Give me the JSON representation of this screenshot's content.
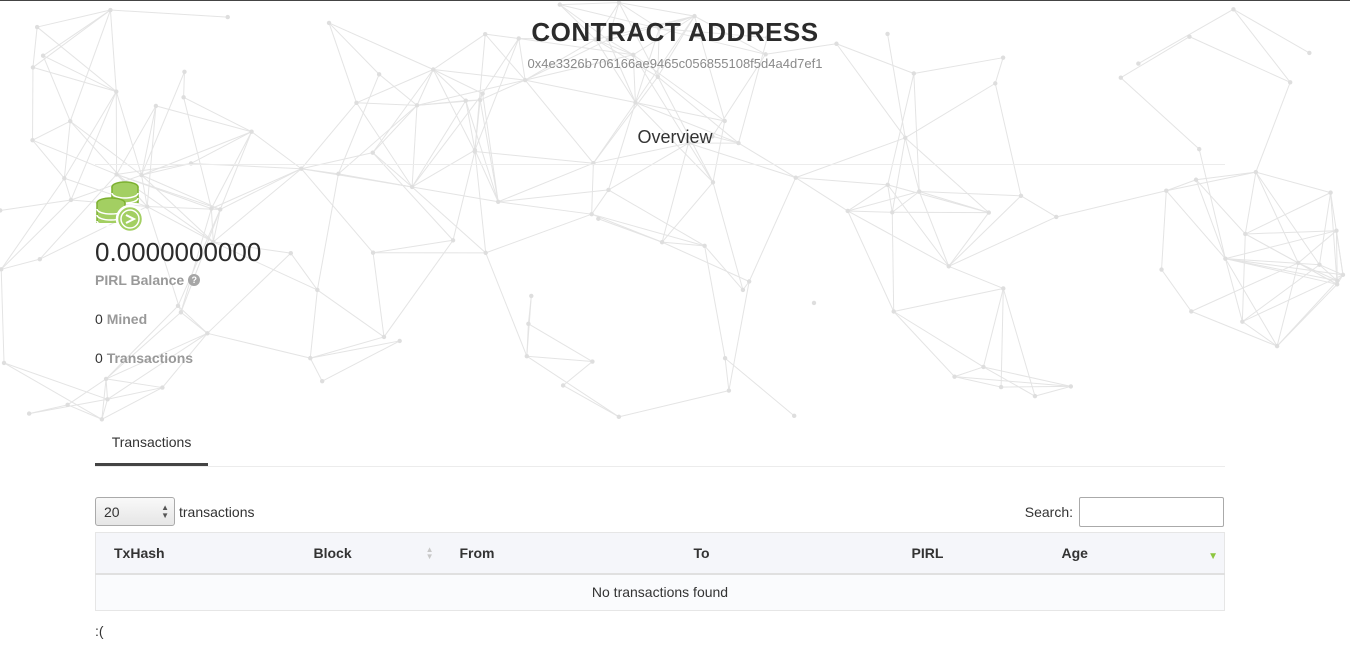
{
  "header": {
    "title": "CONTRACT ADDRESS",
    "address": "0x4e3326b706166ae9465c056855108f5d4a4d7ef1"
  },
  "overview": {
    "title": "Overview",
    "balance_value": "0.0000000000",
    "balance_label": "PIRL Balance",
    "mined_count": "0",
    "mined_label": "Mined",
    "transactions_count": "0",
    "transactions_label": "Transactions",
    "icon": "coins-icon"
  },
  "tabs": [
    {
      "label": "Transactions",
      "active": true
    }
  ],
  "table_controls": {
    "length_value": "20",
    "length_label": "transactions",
    "search_label": "Search:",
    "search_value": "",
    "search_placeholder": ""
  },
  "table": {
    "columns": [
      "TxHash",
      "Block",
      "From",
      "To",
      "PIRL",
      "Age"
    ],
    "empty_message": "No transactions found"
  },
  "footer": {
    "note": ":("
  },
  "colors": {
    "accent_green": "#8dc63f",
    "tab_underline": "#444444",
    "muted_text": "#999999"
  }
}
